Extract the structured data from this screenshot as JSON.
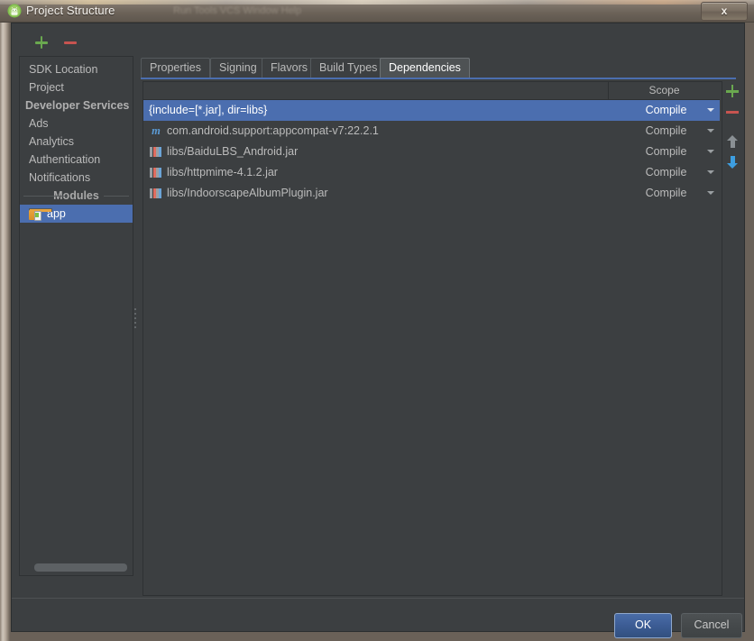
{
  "window": {
    "title": "Project Structure",
    "ghost_title": "Run  Tools  VCS  Window  Help",
    "close_label": "x",
    "app_icon": "android-studio-icon"
  },
  "toolbar": {
    "add_label": "+",
    "remove_label": "−"
  },
  "sidebar": {
    "items": [
      {
        "label": "SDK Location",
        "type": "item",
        "selected": false
      },
      {
        "label": "Project",
        "type": "item",
        "selected": false
      },
      {
        "label": "Developer Services",
        "type": "header",
        "selected": false
      },
      {
        "label": "Ads",
        "type": "item",
        "selected": false
      },
      {
        "label": "Analytics",
        "type": "item",
        "selected": false
      },
      {
        "label": "Authentication",
        "type": "item",
        "selected": false
      },
      {
        "label": "Notifications",
        "type": "item",
        "selected": false
      },
      {
        "label": "Modules",
        "type": "separator",
        "selected": false
      },
      {
        "label": "app",
        "type": "module",
        "selected": true,
        "icon": "android-module-icon"
      }
    ]
  },
  "tabs": [
    {
      "label": "Properties",
      "active": false
    },
    {
      "label": "Signing",
      "active": false
    },
    {
      "label": "Flavors",
      "active": false
    },
    {
      "label": "Build Types",
      "active": false
    },
    {
      "label": "Dependencies",
      "active": true
    }
  ],
  "table": {
    "columns": [
      "",
      "Scope"
    ],
    "rows": [
      {
        "name": "{include=[*.jar], dir=libs}",
        "scope": "Compile",
        "icon": "none",
        "selected": true
      },
      {
        "name": "com.android.support:appcompat-v7:22.2.1",
        "scope": "Compile",
        "icon": "maven-icon",
        "selected": false
      },
      {
        "name": "libs/BaiduLBS_Android.jar",
        "scope": "Compile",
        "icon": "library-icon",
        "selected": false
      },
      {
        "name": "libs/httpmime-4.1.2.jar",
        "scope": "Compile",
        "icon": "library-icon",
        "selected": false
      },
      {
        "name": "libs/IndoorscapeAlbumPlugin.jar",
        "scope": "Compile",
        "icon": "library-icon",
        "selected": false
      }
    ]
  },
  "right_toolbar": {
    "add_label": "+",
    "remove_label": "−",
    "move_up": "arrow-up-icon",
    "move_down": "arrow-down-icon"
  },
  "footer": {
    "ok_label": "OK",
    "cancel_label": "Cancel"
  },
  "colors": {
    "selection_blue": "#4b6eaf",
    "panel_bg": "#3c3f41",
    "accent_green": "#6aa84f",
    "accent_red": "#c75450",
    "accent_blue": "#3d9ee0"
  }
}
